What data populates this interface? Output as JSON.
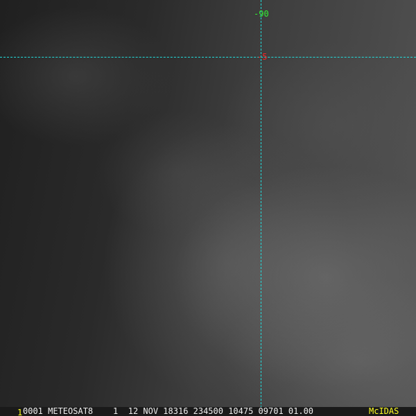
{
  "image": {
    "grid_labels": {
      "longitude": "-90",
      "latitude": "-5"
    },
    "status_bar": {
      "frame": "1",
      "text": "0001 METEOSAT8    1  12 NOV 18316 234500 10475 09701 01.00",
      "brand": "McIDAS"
    },
    "colors": {
      "grid": "#22dddd",
      "lon_label": "#33ee33",
      "lat_label": "#ff2222",
      "brand": "#ffff22"
    }
  }
}
